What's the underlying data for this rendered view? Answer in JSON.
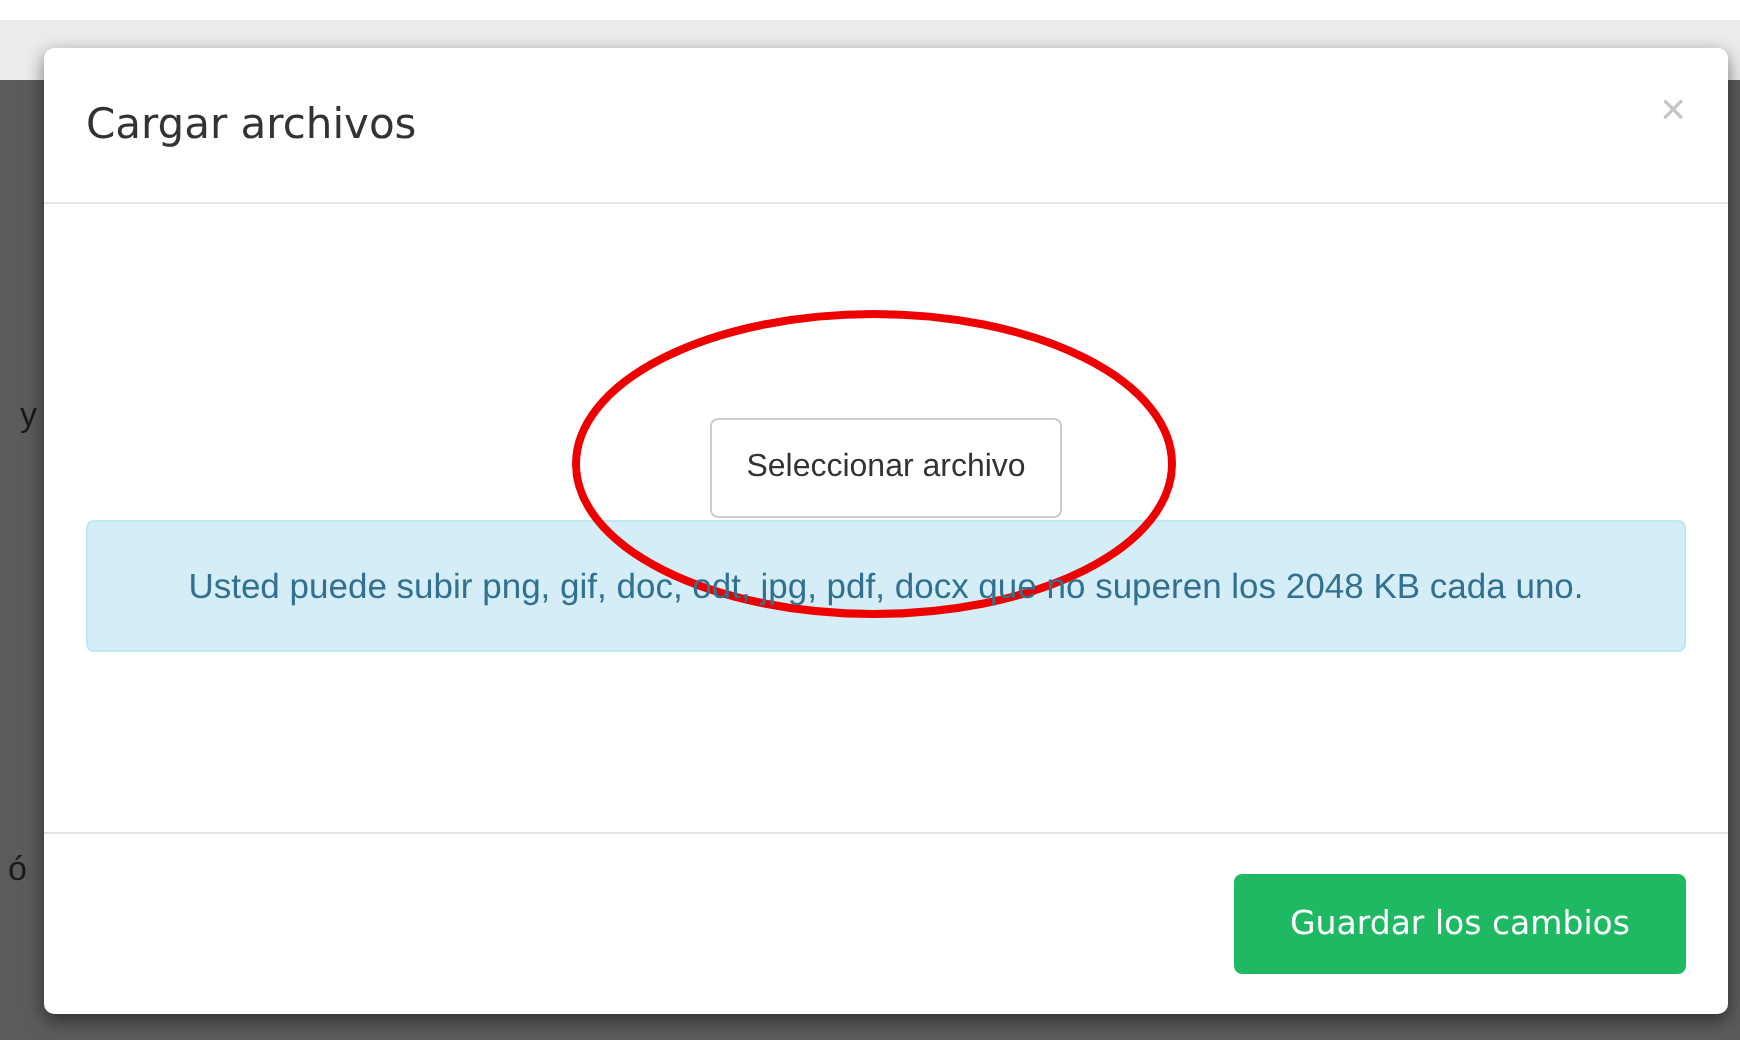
{
  "background": {
    "texts": [
      "y",
      "ó"
    ]
  },
  "modal": {
    "title": "Cargar archivos",
    "close": "×",
    "file_button": "Seleccionar archivo",
    "info": "Usted puede subir png, gif, doc, odt, jpg, pdf, docx que no superen los 2048 KB cada uno.",
    "save_button": "Guardar los cambios"
  },
  "annotations": [
    {
      "kind": "ellipse"
    }
  ]
}
